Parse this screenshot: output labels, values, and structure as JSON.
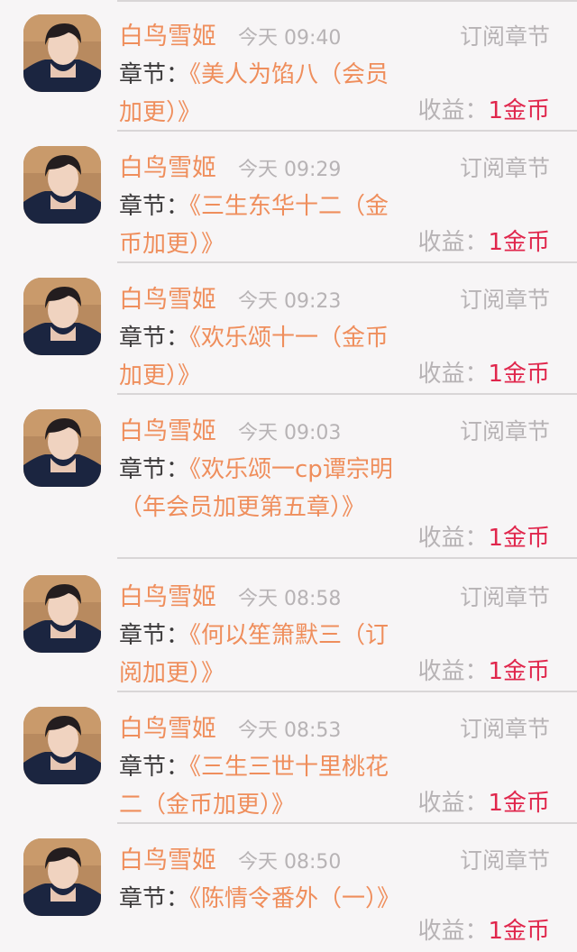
{
  "colors": {
    "name": "#ef8e5c",
    "chapter_title": "#ef8e5c",
    "muted": "#b7b3b5",
    "income_value": "#e0264c",
    "label": "#3d3b3c",
    "background": "#f7f5f6"
  },
  "items": [
    {
      "name": "白鸟雪姬",
      "time": "今天 09:40",
      "type": "订阅章节",
      "chapter_label": "章节：",
      "chapter_title": "《美人为馅八（会员加更）》",
      "income_label": "收益：",
      "income_value": "1金币"
    },
    {
      "name": "白鸟雪姬",
      "time": "今天 09:29",
      "type": "订阅章节",
      "chapter_label": "章节：",
      "chapter_title": "《三生东华十二（金币加更）》",
      "income_label": "收益：",
      "income_value": "1金币"
    },
    {
      "name": "白鸟雪姬",
      "time": "今天 09:23",
      "type": "订阅章节",
      "chapter_label": "章节：",
      "chapter_title": "《欢乐颂十一（金币加更）》",
      "income_label": "收益：",
      "income_value": "1金币"
    },
    {
      "name": "白鸟雪姬",
      "time": "今天 09:03",
      "type": "订阅章节",
      "chapter_label": "章节：",
      "chapter_title": "《欢乐颂一cp谭宗明（年会员加更第五章）》",
      "income_label": "收益：",
      "income_value": "1金币"
    },
    {
      "name": "白鸟雪姬",
      "time": "今天 08:58",
      "type": "订阅章节",
      "chapter_label": "章节：",
      "chapter_title": "《何以笙箫默三（订阅加更）》",
      "income_label": "收益：",
      "income_value": "1金币"
    },
    {
      "name": "白鸟雪姬",
      "time": "今天 08:53",
      "type": "订阅章节",
      "chapter_label": "章节：",
      "chapter_title": "《三生三世十里桃花二（金币加更）》",
      "income_label": "收益：",
      "income_value": "1金币"
    },
    {
      "name": "白鸟雪姬",
      "time": "今天 08:50",
      "type": "订阅章节",
      "chapter_label": "章节：",
      "chapter_title": "《陈情令番外（一）》",
      "income_label": "收益：",
      "income_value": "1金币"
    }
  ]
}
